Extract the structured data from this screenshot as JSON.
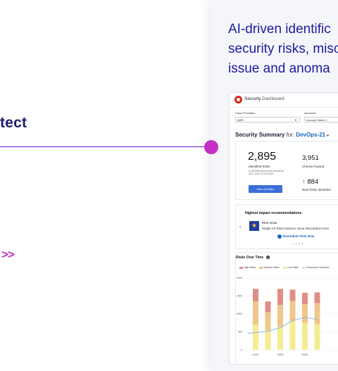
{
  "left": {
    "heading_fragment": "tect",
    "arrows": ">>"
  },
  "headline": {
    "line1": "AI-driven identific",
    "line2": "security risks, misc",
    "line3": "issue and anoma"
  },
  "dashboard": {
    "brand": "Security",
    "section": "Dashboard",
    "filters": {
      "cloud_providers_label": "Cloud Providers",
      "cloud_provider_value": "AWS",
      "accounts_label": "Accounts",
      "account_value": "Account Name 1"
    },
    "summary": {
      "title": "Security Summary",
      "for_label": "for:",
      "project": "DevOps-21",
      "identified_count": "2,895",
      "identified_label": "Identified Risks",
      "scan_note": "11,393 Resources were scanned at 03.01.2021 10:23:45 AM",
      "view_all_label": "View All Risks",
      "checks_count": "3,951",
      "checks_label": "Checks Passed",
      "new_risks_count": "884",
      "new_risks_label": "New Risks Identified"
    },
    "recommendations": {
      "title": "Highest impact recommendations",
      "issue_title": "RDS Issue",
      "issue_desc": "Single AZ RDS Instance Issue Description Here",
      "action_label": "Remediate Risk Now"
    },
    "risks_over_time": {
      "title": "Risks Over Time",
      "legend": [
        "High Risks",
        "Medium Risks",
        "Low Risks",
        "Resources Scanned"
      ]
    }
  },
  "colors": {
    "high": "#e08e86",
    "medium": "#f0c78a",
    "low": "#f3ec92",
    "resources": "#8ab6e6"
  },
  "chart_data": {
    "type": "bar",
    "title": "Risks Over Time",
    "categories": [
      "01/04",
      "02/04",
      "03/04",
      "04/04",
      "05/04",
      "06/04"
    ],
    "ylim": [
      0,
      2000
    ],
    "yticks": [
      "0",
      "500",
      "1000",
      "1500",
      "2000"
    ],
    "series": [
      {
        "name": "Low Risks",
        "values": [
          700,
          550,
          650,
          800,
          750,
          720
        ]
      },
      {
        "name": "Medium Risks",
        "values": [
          650,
          500,
          600,
          560,
          520,
          580
        ]
      },
      {
        "name": "High Risks",
        "values": [
          350,
          300,
          450,
          320,
          320,
          300
        ]
      }
    ],
    "line_series": {
      "name": "Resources Scanned",
      "values": [
        480,
        520,
        620,
        820,
        900,
        850
      ]
    }
  }
}
